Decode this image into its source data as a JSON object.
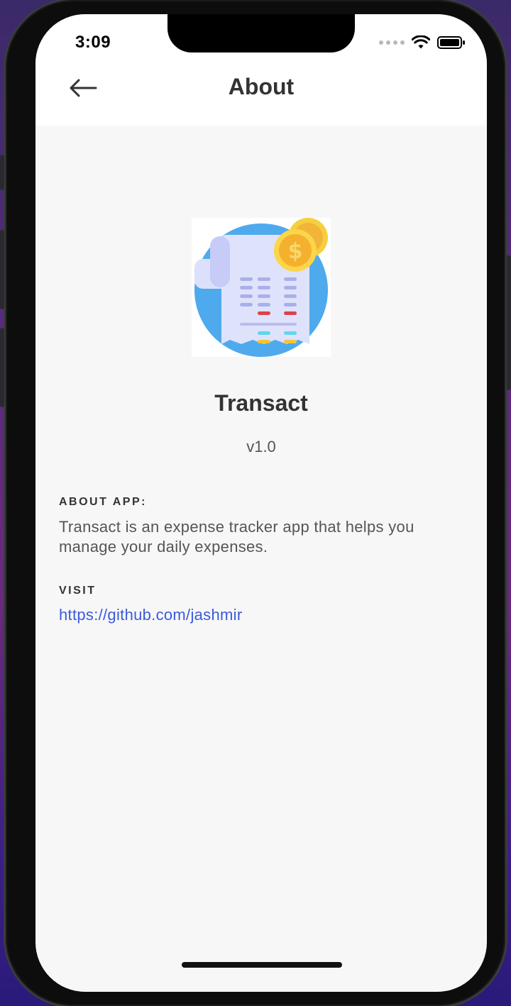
{
  "status_bar": {
    "time": "3:09",
    "icons": [
      "signal-dots-icon",
      "wifi-icon",
      "battery-icon"
    ]
  },
  "header": {
    "title": "About",
    "back_icon": "arrow-left-icon"
  },
  "app": {
    "logo_icon": "receipt-with-coins-icon",
    "name": "Transact",
    "version": "v1.0"
  },
  "about_section": {
    "label": "ABOUT APP:",
    "text": "Transact is an expense tracker app that helps you manage your daily expenses."
  },
  "visit_section": {
    "label": "VISIT",
    "link": "https://github.com/jashmir"
  },
  "colors": {
    "background": "#f7f7f7",
    "header_bg": "#ffffff",
    "link": "#3b5bdb",
    "text_dark": "#333333",
    "text_muted": "#555555"
  }
}
